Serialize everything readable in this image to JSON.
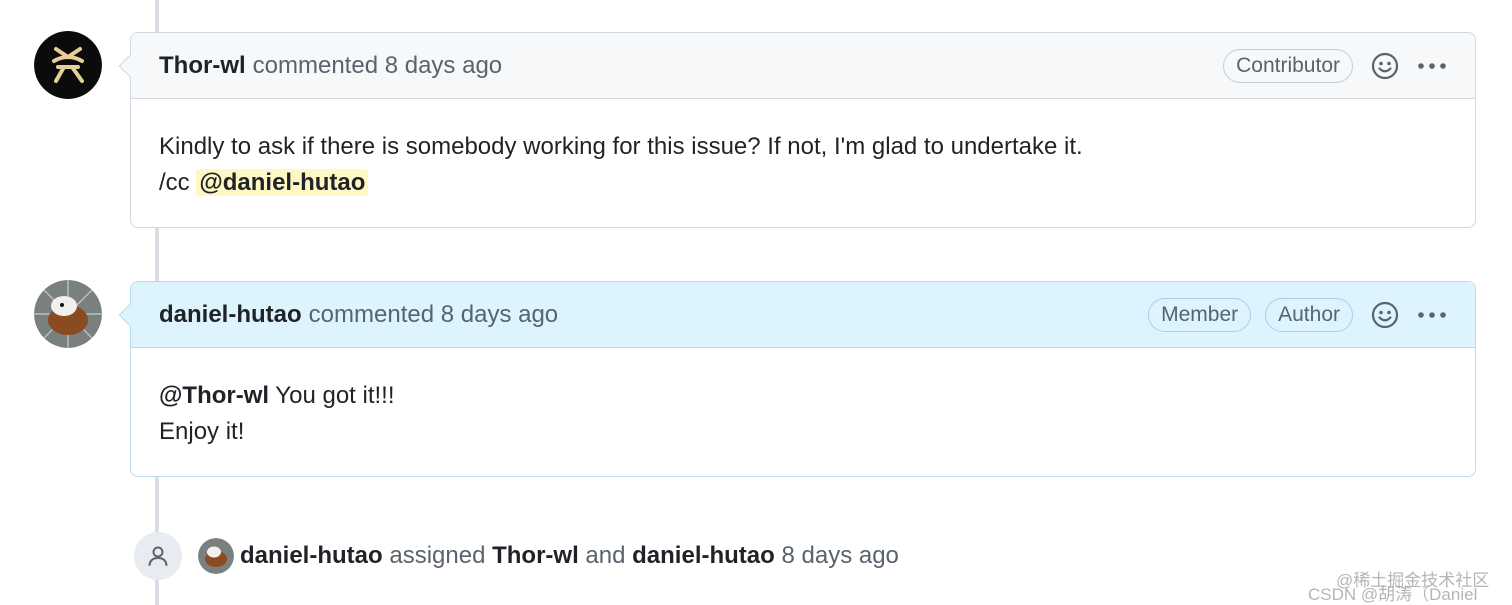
{
  "comments": [
    {
      "author": "Thor-wl",
      "meta": "commented 8 days ago",
      "badges": [
        "Contributor"
      ],
      "line1": "Kindly to ask if there is somebody working for this issue? If not, I'm glad to undertake it.",
      "line2_prefix": "/cc",
      "line2_mention": "@daniel-hutao"
    },
    {
      "author": "daniel-hutao",
      "meta": "commented 8 days ago",
      "badges": [
        "Member",
        "Author"
      ],
      "line1_mention": "@Thor-wl",
      "line1_rest": " You got it!!!",
      "line2": "Enjoy it!"
    }
  ],
  "event": {
    "actor": "daniel-hutao",
    "verb": "assigned",
    "assignee1": "Thor-wl",
    "conj": "and",
    "assignee2": "daniel-hutao",
    "time": "8 days ago"
  },
  "watermark": {
    "line1": "@稀土掘金技术社区",
    "line2": "CSDN @胡涛（Daniel Hu）"
  },
  "icons": {
    "reaction": "smiley-icon",
    "more": "kebab-horizontal-icon",
    "event": "person-icon"
  },
  "colors": {
    "self_header_bg": "#ddf4ff",
    "mention_highlight": "#fff8c5",
    "timeline_line": "#d8dee4"
  }
}
